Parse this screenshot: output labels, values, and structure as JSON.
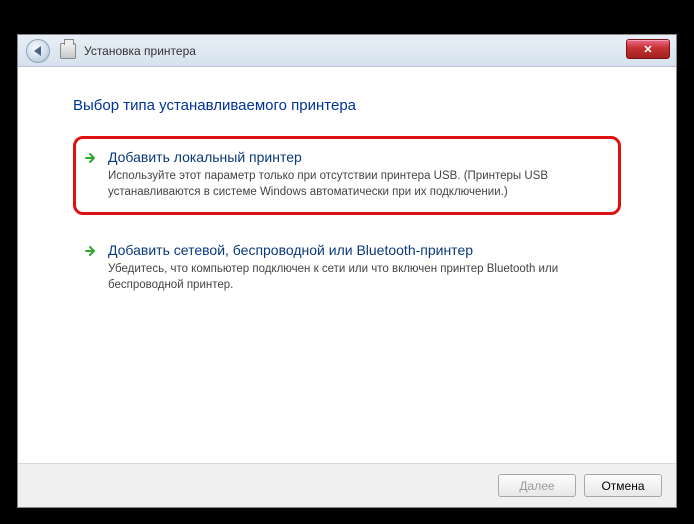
{
  "window": {
    "title": "Установка принтера"
  },
  "heading": "Выбор типа устанавливаемого принтера",
  "options": [
    {
      "title": "Добавить локальный принтер",
      "desc": "Используйте этот параметр только при отсутствии принтера USB. (Принтеры USB устанавливаются в системе Windows автоматически при их подключении.)"
    },
    {
      "title": "Добавить сетевой, беспроводной или Bluetooth-принтер",
      "desc": "Убедитесь, что компьютер подключен к сети или что включен принтер Bluetooth или беспроводной принтер."
    }
  ],
  "buttons": {
    "next": "Далее",
    "cancel": "Отмена"
  }
}
